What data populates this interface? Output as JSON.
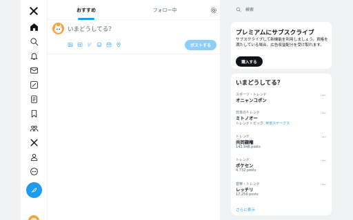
{
  "tabs": {
    "for_you": "おすすめ",
    "following": "フォロー中"
  },
  "composer": {
    "placeholder": "いまどうしてる？",
    "post_button": "ポストする"
  },
  "search": {
    "placeholder": "検索"
  },
  "premium": {
    "title": "プレミアムにサブスクライブ",
    "description": "サブスクライブして新機能を利用しましょう。資格を満たしている場合、広告収益配分を受け取れます。",
    "button": "購入する"
  },
  "trends": {
    "title": "いまどうしてる？",
    "items": [
      {
        "category": "スポーツ・トレンド",
        "name": "オニャンコポン",
        "meta": ""
      },
      {
        "category": "日本のトレンド",
        "name": "ミトノオー",
        "meta_prefix": "トレンドトピック: ",
        "meta_link": "甲安ステークス"
      },
      {
        "category": "トレンド",
        "name": "共同親権",
        "meta": "142,948 posts"
      },
      {
        "category": "トレンド",
        "name": "ポケセン",
        "meta": "4,732 posts"
      },
      {
        "category": "音楽・トレンド",
        "name": "レッチリ",
        "meta": "17,256 posts"
      }
    ],
    "more_glyph": "…",
    "show_more": "さらに表示"
  },
  "nav": {
    "items": [
      "x-logo",
      "home-icon",
      "search-icon",
      "bell-icon",
      "mail-icon",
      "grok-icon",
      "lists-icon",
      "bookmark-icon",
      "communities-icon",
      "premium-x-icon",
      "profile-icon",
      "more-icon",
      "post-compose-icon"
    ]
  },
  "colors": {
    "accent": "#1d9bf0",
    "text": "#0f1419",
    "muted": "#536471",
    "page_bg": "#f0f1f2"
  }
}
